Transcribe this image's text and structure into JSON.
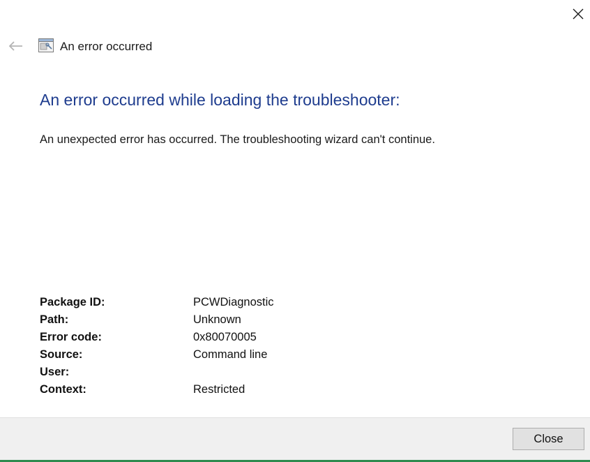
{
  "window": {
    "title": "An error occurred",
    "icons": {
      "close": "close-icon",
      "back": "back-arrow-icon",
      "app": "troubleshooter-icon"
    }
  },
  "main": {
    "heading": "An error occurred while loading the troubleshooter:",
    "message": "An unexpected error has occurred. The troubleshooting wizard can't continue."
  },
  "details": [
    {
      "label": "Package ID:",
      "value": "PCWDiagnostic"
    },
    {
      "label": "Path:",
      "value": "Unknown"
    },
    {
      "label": "Error code:",
      "value": "0x80070005"
    },
    {
      "label": "Source:",
      "value": "Command line"
    },
    {
      "label": "User:",
      "value": ""
    },
    {
      "label": "Context:",
      "value": "Restricted"
    }
  ],
  "footer": {
    "close_label": "Close"
  },
  "colors": {
    "heading": "#1e3c8e",
    "footer_bg": "#f0f0f0",
    "accent_line": "#2d8a4e"
  }
}
